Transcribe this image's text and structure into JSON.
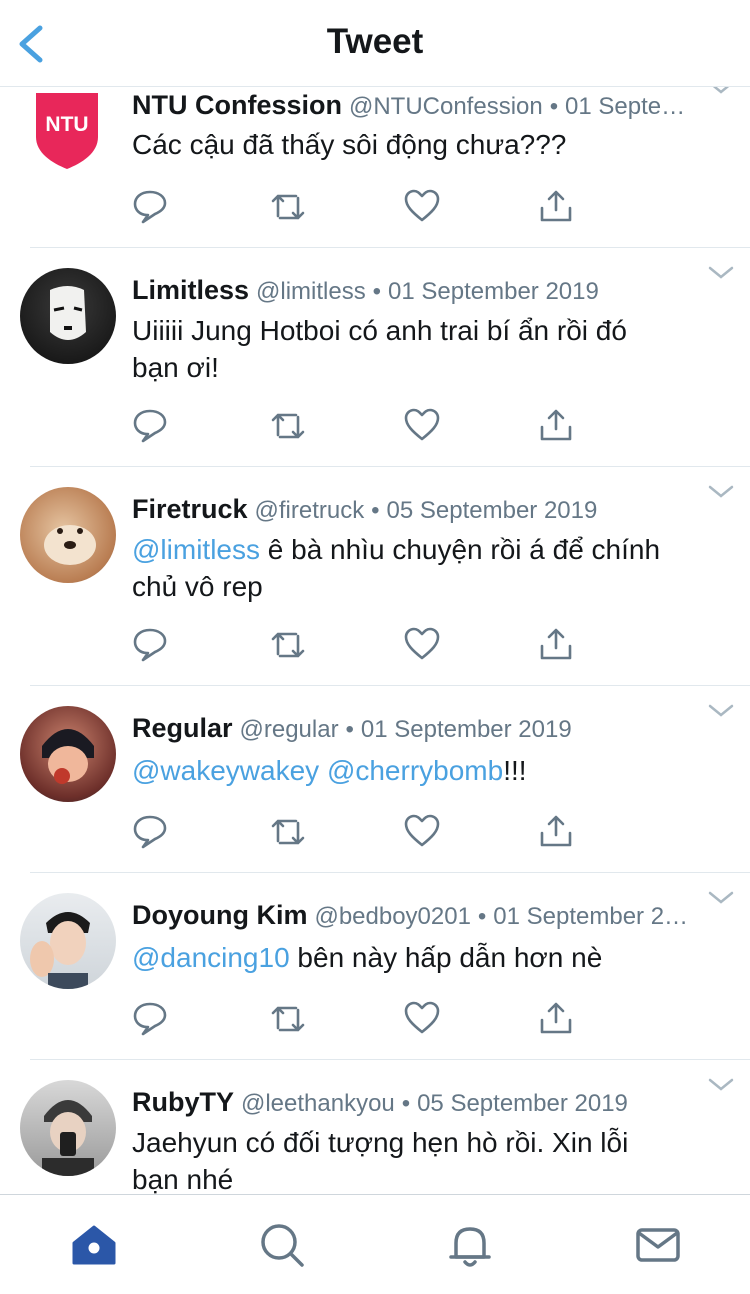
{
  "header": {
    "title": "Tweet",
    "back_icon": "chevron-left-icon"
  },
  "colors": {
    "accent": "#4aa1e0",
    "text": "#14171a",
    "muted": "#657786",
    "icon": "#657786",
    "tab_active": "#2b57a8"
  },
  "tweets": [
    {
      "name": "NTU Confession",
      "handle": "@NTUConfession",
      "dot": "•",
      "date": "01 Septe…",
      "avatar_text": "NTU",
      "lines": [
        [
          {
            "t": "Các cậu đã thấy sôi động chưa???"
          }
        ]
      ]
    },
    {
      "name": "Limitless",
      "handle": "@limitless",
      "dot": "•",
      "date": "01 September 2019",
      "lines": [
        [
          {
            "t": "Uiiiii Jung Hotboi có anh trai bí ẩn rồi đó"
          }
        ],
        [
          {
            "t": "bạn ơi!"
          }
        ]
      ]
    },
    {
      "name": "Firetruck",
      "handle": "@firetruck",
      "dot": "•",
      "date": "05 September 2019",
      "lines": [
        [
          {
            "t": "@limitless",
            "m": true
          },
          {
            "t": " ê bà nhìu chuyện rồi á để chính"
          }
        ],
        [
          {
            "t": "chủ vô rep"
          }
        ]
      ]
    },
    {
      "name": "Regular",
      "handle": "@regular",
      "dot": "•",
      "date": "01 September 2019",
      "lines": [
        [
          {
            "t": "@wakeywakey",
            "m": true
          },
          {
            "t": " "
          },
          {
            "t": "@cherrybomb",
            "m": true
          },
          {
            "t": "!!!"
          }
        ]
      ]
    },
    {
      "name": "Doyoung Kim",
      "handle": "@bedboy0201",
      "dot": "•",
      "date": "01 September 2…",
      "lines": [
        [
          {
            "t": "@dancing10",
            "m": true
          },
          {
            "t": " bên này hấp dẫn hơn nè"
          }
        ]
      ]
    },
    {
      "name": "RubyTY",
      "handle": "@leethankyou",
      "dot": "•",
      "date": "05 September 2019",
      "lines": [
        [
          {
            "t": "Jaehyun có đối tượng hẹn hò rồi. Xin lỗi"
          }
        ],
        [
          {
            "t": "bạn nhé"
          }
        ]
      ]
    }
  ],
  "action_icons": [
    "reply-icon",
    "retweet-icon",
    "like-icon",
    "share-icon"
  ],
  "tabbar": {
    "items": [
      "home-icon",
      "search-icon",
      "notifications-icon",
      "messages-icon"
    ]
  }
}
